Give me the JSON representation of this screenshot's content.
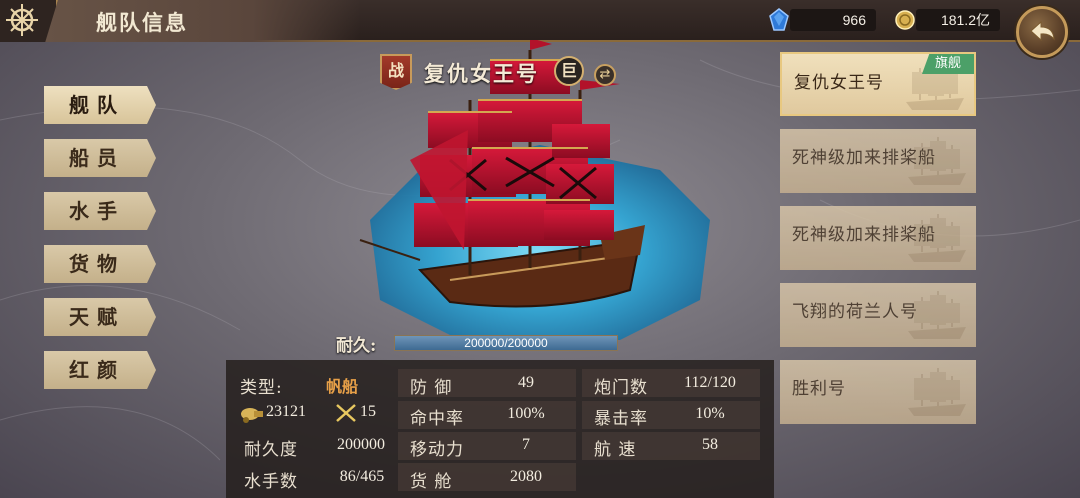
{
  "header": {
    "title": "舰队信息",
    "gems": "966",
    "gold": "181.2亿"
  },
  "nav": {
    "items": [
      {
        "label": "舰队",
        "active": true
      },
      {
        "label": "船员",
        "active": false
      },
      {
        "label": "水手",
        "active": false
      },
      {
        "label": "货物",
        "active": false
      },
      {
        "label": "天赋",
        "active": false
      },
      {
        "label": "红颜",
        "active": false
      }
    ]
  },
  "ship": {
    "tag": "战",
    "name": "复仇女王号",
    "size_badge": "巨",
    "durability_label": "耐久:",
    "durability_text": "200000/200000",
    "durability_fraction": 1.0
  },
  "stats": {
    "type_label": "类型:",
    "type_value": "帆船",
    "cannon_power": "23121",
    "crew_power": "15",
    "durability_label": "耐久度",
    "durability_value": "200000",
    "sailors_label": "水手数",
    "sailors_value": "86/465",
    "defense_label": "防 御",
    "defense_value": "49",
    "hit_label": "命中率",
    "hit_value": "100%",
    "move_label": "移动力",
    "move_value": "7",
    "cargo_label": "货 舱",
    "cargo_value": "2080",
    "gunport_label": "炮门数",
    "gunport_value": "112/120",
    "crit_label": "暴击率",
    "crit_value": "10%",
    "speed_label": "航 速",
    "speed_value": "58"
  },
  "fleet": {
    "flag_label": "旗舰",
    "ships": [
      {
        "name": "复仇女王号",
        "active": true
      },
      {
        "name": "死神级加来排桨船",
        "active": false
      },
      {
        "name": "死神级加来排桨船",
        "active": false
      },
      {
        "name": "飞翔的荷兰人号",
        "active": false
      },
      {
        "name": "胜利号",
        "active": false
      }
    ]
  },
  "colors": {
    "accent_gold": "#c89a5a",
    "sail_red": "#b3122a",
    "water_blue": "#3aa8d8"
  }
}
